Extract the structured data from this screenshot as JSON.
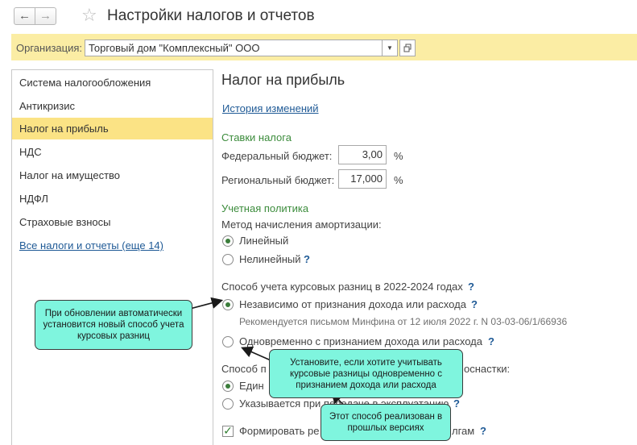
{
  "header": {
    "back_icon": "←",
    "forward_icon": "→",
    "favorite_icon": "☆",
    "title": "Настройки налогов и отчетов"
  },
  "org": {
    "label": "Организация:",
    "value": "Торговый дом \"Комплексный\" ООО",
    "dropdown_icon": "▼"
  },
  "sidebar": {
    "items": [
      {
        "label": "Система налогообложения"
      },
      {
        "label": "Антикризис"
      },
      {
        "label": "Налог на прибыль"
      },
      {
        "label": "НДС"
      },
      {
        "label": "Налог на имущество"
      },
      {
        "label": "НДФЛ"
      },
      {
        "label": "Страховые взносы"
      }
    ],
    "all_link": "Все налоги и отчеты (еще 14)"
  },
  "main": {
    "title": "Налог на прибыль",
    "history_link": "История изменений",
    "rates": {
      "title": "Ставки налога",
      "federal_label": "Федеральный бюджет:",
      "federal_value": "3,00",
      "regional_label": "Региональный бюджет:",
      "regional_value": "17,000",
      "percent": "%"
    },
    "policy": {
      "title": "Учетная политика",
      "depreciation_label": "Метод начисления амортизации:",
      "linear": "Линейный",
      "nonlinear": "Нелинейный",
      "help": "?",
      "fx_label": "Способ учета курсовых разниц в 2022-2024 годах",
      "fx_independent": "Независимо от признания дохода или расхода",
      "fx_note": "Рекомендуется письмом Минфина от 12 июля 2022 г. N 03-03-06/1/66936",
      "fx_simultaneous": "Одновременно с признанием дохода или расхода",
      "workwear_label_start": "Способ п",
      "workwear_label_end": "оснастки:",
      "workwear_one_start": "Един",
      "workwear_transfer": "Указывается при передаче в эксплуатацию",
      "form_check_start": "Формировать ре",
      "form_check_end": "лгам"
    }
  },
  "callouts": {
    "auto_update": "При обновлении автоматически установится новый способ учета курсовых разниц",
    "simultaneous_hint": "Установите, если хотите учитывать курсовые разницы одновременно с признанием дохода или расхода",
    "old_method": "Этот способ реализован в прошлых версиях"
  }
}
